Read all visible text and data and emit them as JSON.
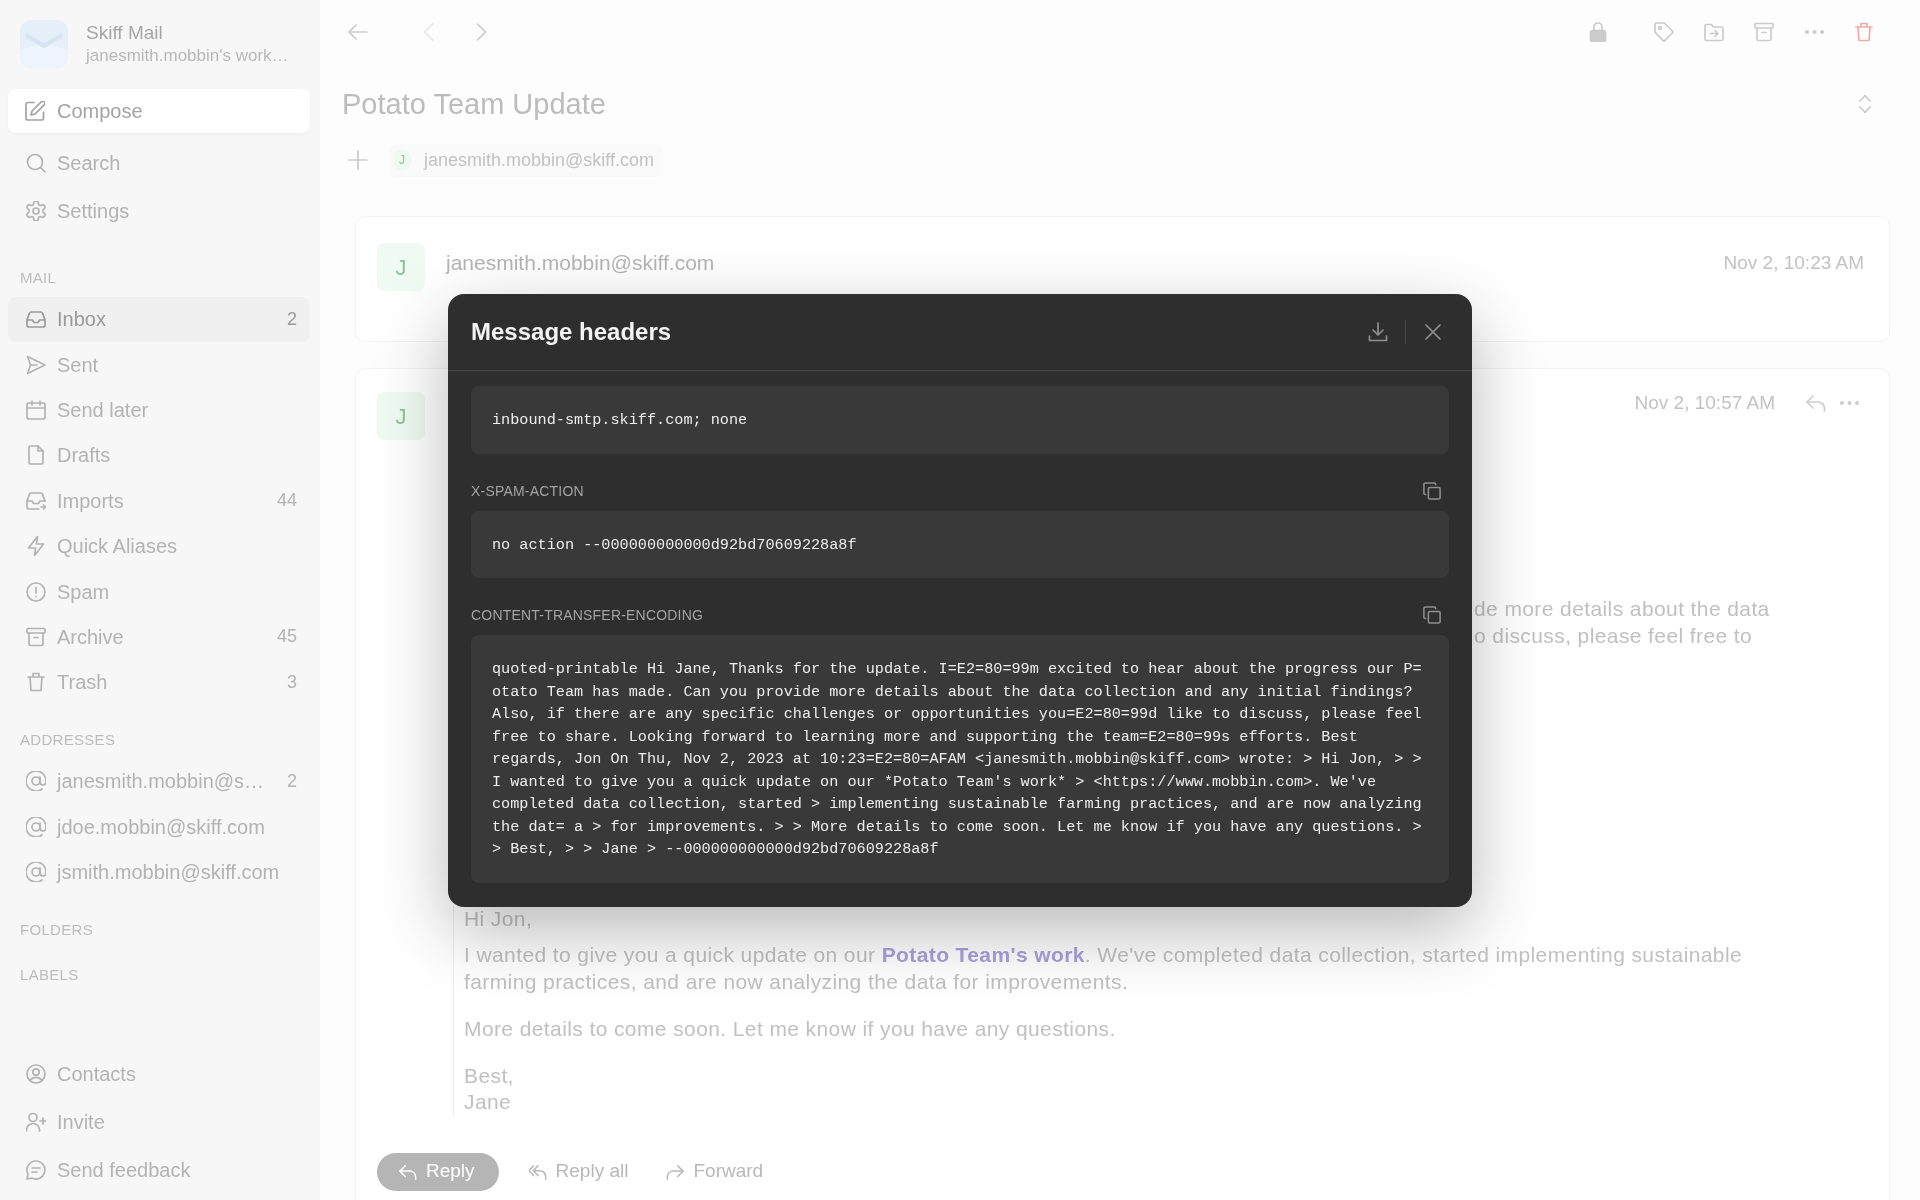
{
  "sidebar": {
    "app_name": "Skiff Mail",
    "workspace": "janesmith.mobbin's work…",
    "compose": "Compose",
    "actions": [
      "Search",
      "Settings"
    ],
    "sections": [
      {
        "title": "MAIL",
        "items": [
          {
            "label": "Inbox",
            "count": "2",
            "selected": true
          },
          {
            "label": "Sent",
            "selected": false
          },
          {
            "label": "Send later",
            "selected": false
          },
          {
            "label": "Drafts",
            "selected": false
          },
          {
            "label": "Imports",
            "count": "44",
            "selected": false
          },
          {
            "label": "Quick Aliases",
            "selected": false
          },
          {
            "label": "Spam",
            "selected": false
          },
          {
            "label": "Archive",
            "count": "45",
            "selected": false
          },
          {
            "label": "Trash",
            "count": "3",
            "selected": false
          }
        ]
      },
      {
        "title": "ADDRESSES",
        "items": [
          {
            "label": "janesmith.mobbin@s…",
            "count": "2",
            "selected": false
          },
          {
            "label": "jdoe.mobbin@skiff.com",
            "selected": false
          },
          {
            "label": "jsmith.mobbin@skiff.com",
            "selected": false
          }
        ]
      },
      {
        "title": "FOLDERS"
      },
      {
        "title": "LABELS"
      }
    ],
    "footer": [
      "Contacts",
      "Invite",
      "Send feedback"
    ]
  },
  "toolbar": {
    "previous": {
      "disabled": true
    },
    "next": {
      "disabled": false
    }
  },
  "thread": {
    "title": "Potato Team Update",
    "participants": [
      {
        "initial": "J",
        "address": "janesmith.mobbin@skiff.com"
      }
    ],
    "messages": [
      {
        "initial": "J",
        "sender": "janesmith.mobbin@skiff.com",
        "date": "Nov 2, 10:23 AM"
      },
      {
        "initial": "J",
        "date": "Nov 2, 10:57 AM",
        "visible_text": [
          "de more details about the data",
          "o discuss, please feel free to"
        ],
        "quote": {
          "greeting": "Hi Jon,",
          "update": {
            "before": "I wanted to give you a quick update on our ",
            "link": "Potato Team's work",
            "after": ". We've completed data collection, started implementing sustainable farming practices, and are now analyzing the data for improvements."
          },
          "note": "More details to come soon. Let me know if you have any questions.",
          "sign_off": "Best,",
          "signature": "Jane"
        }
      }
    ],
    "reply_actions": [
      "Reply",
      "Reply all",
      "Forward"
    ]
  },
  "headers_dialog": {
    "title": "Message headers",
    "headers": [
      {
        "value": "inbound-smtp.skiff.com; none"
      },
      {
        "name": "X-SPAM-ACTION",
        "value": "no action --000000000000d92bd70609228a8f"
      },
      {
        "name": "CONTENT-TRANSFER-ENCODING",
        "value": "quoted-printable Hi Jane, Thanks for the update. I=E2=80=99m excited to hear about the progress our P= otato Team has made. Can you provide more details about the data collection and any initial findings? Also, if there are any specific challenges or opportunities you=E2=80=99d like to discuss, please feel free to share. Looking forward to learning more and supporting the team=E2=80=99s efforts. Best regards, Jon On Thu, Nov 2, 2023 at 10:23=E2=80=AFAM <janesmith.mobbin@skiff.com> wrote: > Hi Jon, > > I wanted to give you a quick update on our *Potato Team's work* > <https://www.mobbin.com>. We've completed data collection, started > implementing sustainable farming practices, and are now analyzing the dat= a > for improvements. > > More details to come soon. Let me know if you have any questions. > > Best, > > Jane > --000000000000d92bd70609228a8f"
      }
    ]
  }
}
